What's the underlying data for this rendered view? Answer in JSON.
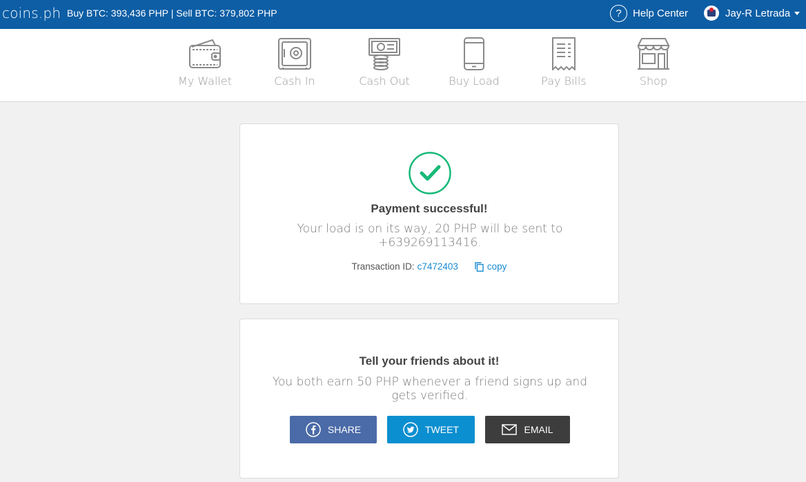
{
  "header": {
    "logo": "coins.ph",
    "rates": "Buy BTC: 393,436 PHP | Sell BTC: 379,802 PHP",
    "help_icon": "?",
    "help_label": "Help Center",
    "user_name": "Jay-R Letrada"
  },
  "nav": {
    "items": [
      {
        "label": "My Wallet",
        "icon": "wallet-icon"
      },
      {
        "label": "Cash In",
        "icon": "safe-icon"
      },
      {
        "label": "Cash Out",
        "icon": "cash-icon"
      },
      {
        "label": "Buy Load",
        "icon": "phone-icon"
      },
      {
        "label": "Pay Bills",
        "icon": "receipt-icon"
      },
      {
        "label": "Shop",
        "icon": "store-icon"
      }
    ]
  },
  "payment": {
    "title": "Payment successful!",
    "message": "Your load is on its way, 20 PHP will be sent to +639269113416.",
    "transaction_label": "Transaction ID:",
    "transaction_id": "c7472403",
    "copy_label": "copy"
  },
  "referral": {
    "title": "Tell your friends about it!",
    "message": "You both earn 50 PHP whenever a friend signs up and gets verified.",
    "share_label": "SHARE",
    "tweet_label": "TWEET",
    "email_label": "EMAIL"
  },
  "colors": {
    "header_bg": "#0d5ea5",
    "success_green": "#17b978",
    "link_blue": "#1a8bd0",
    "facebook": "#4a6ba7",
    "twitter": "#0b8fd0",
    "email": "#3d3d3d"
  }
}
